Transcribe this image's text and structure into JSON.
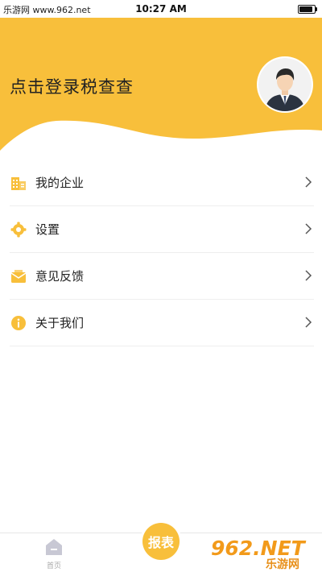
{
  "status_bar": {
    "watermark": "乐游网 www.962.net",
    "time": "10:27 AM",
    "battery_level": 0.9
  },
  "colors": {
    "accent": "#F8BF3B",
    "text": "#222222",
    "divider": "#EEEEEE"
  },
  "header": {
    "login_prompt": "点击登录税查查",
    "avatar_icon": "user-avatar"
  },
  "menu": {
    "items": [
      {
        "label": "我的企业",
        "icon": "building-icon"
      },
      {
        "label": "设置",
        "icon": "gear-icon"
      },
      {
        "label": "意见反馈",
        "icon": "envelope-icon"
      },
      {
        "label": "关于我们",
        "icon": "info-icon"
      }
    ]
  },
  "tabbar": {
    "home_label": "首页",
    "report_label": "报表"
  },
  "watermark_bottom": {
    "logo": "962.NET",
    "sub": "乐游网"
  }
}
